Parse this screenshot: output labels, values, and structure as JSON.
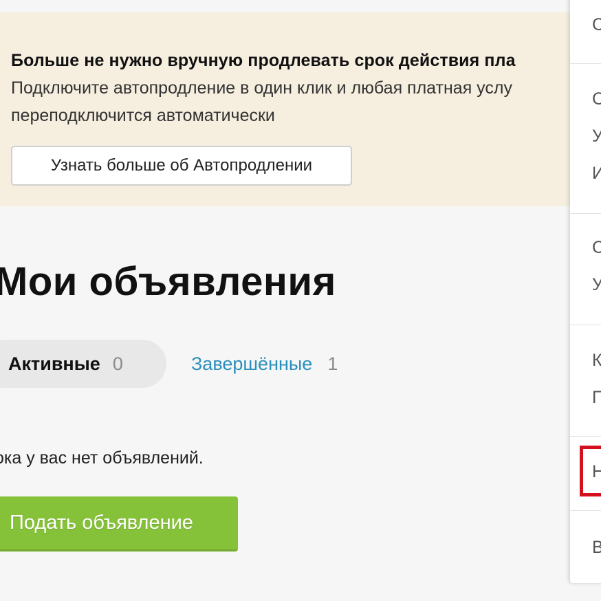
{
  "banner": {
    "title": "Больше не нужно вручную продлевать срок действия пла",
    "text_line1": "Подключите автопродление в один клик и любая платная услу",
    "text_line2": "переподключится автоматически",
    "learn_more_label": "Узнать больше об Автопродлении"
  },
  "main": {
    "title": "Мои объявления",
    "tabs": [
      {
        "label": "Активные",
        "count": "0",
        "active": true
      },
      {
        "label": "Завершённые",
        "count": "1",
        "active": false
      }
    ],
    "empty_text": "ока у вас нет объявлений.",
    "post_ad_label": "Подать объявление"
  },
  "dropdown": {
    "items": [
      "С",
      "С",
      "У",
      "И",
      "С",
      "У",
      "К",
      "П",
      "Н",
      "В"
    ]
  },
  "colors": {
    "banner_bg": "#f6eedf",
    "accent_green": "#86c13a",
    "link_blue": "#2b8fbd",
    "highlight_red": "#d3101c"
  }
}
